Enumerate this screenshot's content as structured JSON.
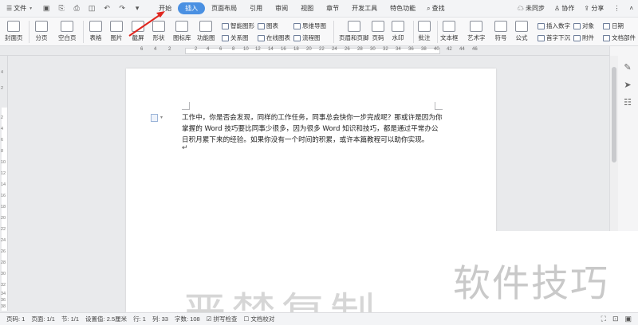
{
  "titlebar": {
    "file_menu": "文件",
    "tabs": [
      "开始",
      "插入",
      "页面布局",
      "引用",
      "审阅",
      "视图",
      "章节",
      "开发工具",
      "特色功能"
    ],
    "active_tab_index": 1,
    "search_label": "查找",
    "right": [
      "未同步",
      "协作",
      "分享"
    ]
  },
  "ribbon": {
    "items": {
      "cover": "封面页",
      "page": "分页",
      "blank": "空白页",
      "table": "表格",
      "picture": "图片",
      "screenshot": "截屏",
      "shape": "形状",
      "iconlib": "图标库",
      "funcgraph": "功能图",
      "smartart": "智能图形",
      "relation": "关系图",
      "chart": "图表",
      "online_chart": "在线图表",
      "mindmap": "思维导图",
      "flowchart": "流程图",
      "header_footer": "页眉和页脚",
      "pagenum": "页码",
      "watermark": "水印",
      "comment": "批注",
      "textbox": "文本框",
      "wordart": "艺术字",
      "symbol": "符号",
      "formula": "公式",
      "insert_number": "插入数字",
      "object": "对象",
      "date": "日期",
      "dropcap": "首字下沉",
      "attachment": "附件",
      "docparts": "文档部件"
    }
  },
  "ruler": {
    "numbers": [
      "6",
      "4",
      "2",
      "2",
      "4",
      "6",
      "8",
      "10",
      "12",
      "14",
      "16",
      "18",
      "20",
      "22",
      "24",
      "26",
      "28",
      "30",
      "32",
      "34",
      "36",
      "38",
      "40",
      "42",
      "44",
      "46"
    ],
    "vnumbers": [
      "4",
      "2",
      "2",
      "4",
      "6",
      "8",
      "10",
      "12",
      "14",
      "16",
      "18",
      "20",
      "22",
      "24",
      "26",
      "28",
      "30",
      "32",
      "34",
      "36",
      "38"
    ]
  },
  "document": {
    "paragraph": "工作中，你是否会发现，同样的工作任务，同事总会快你一步完成呢？那或许是因为你掌握的 Word 技巧要比同事少很多，因为很多 Word 知识和技巧，都是通过平常办公日积月累下来的经验。如果你没有一个时间的积累，或许本篇教程可以助你实现。",
    "paragraph_mark": "↵"
  },
  "watermarks": {
    "brand": "软件技巧",
    "bottom": "严禁复制"
  },
  "statusbar": {
    "page_no": "页码: 1",
    "page": "页面: 1/1",
    "section": "节: 1/1",
    "setting": "设置值: 2.5厘米",
    "row": "行: 1",
    "col": "列: 33",
    "wordcount": "字数: 108",
    "spellcheck": "拼写检查",
    "doccheck": "文档校对"
  },
  "colors": {
    "active_tab": "#4a90e2",
    "annotation_arrow": "#e0261f"
  }
}
